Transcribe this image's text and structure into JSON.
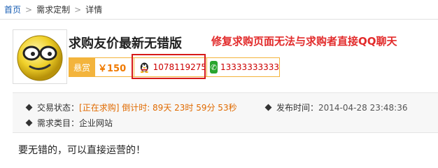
{
  "breadcrumb": {
    "home": "首页",
    "separator": ">",
    "items": [
      "需求定制",
      "详情"
    ]
  },
  "request": {
    "title": "求购友价最新无错版",
    "annotation": "修复求购页面无法与求购者直接QQ聊天",
    "reward": {
      "label": "悬赏",
      "value": "￥150"
    },
    "qq": "1078119275",
    "phone": "13333333333"
  },
  "info": {
    "status_label": "交易状态：",
    "status_value": "[正在求购] 倒计时: 89天 23时 59分 53秒",
    "category_label": "需求类目：",
    "category_value": "企业网站",
    "publish_label": "发布时间：",
    "publish_value": "2014-04-28 23:48:36"
  },
  "description": "要无错的，可以直接运营的！",
  "colors": {
    "accent": "#f3b43c",
    "price": "#f07a00",
    "annotation": "#e22b2b",
    "highlight": "#d61a1a",
    "link": "#1a5fb4"
  },
  "icons": {
    "avatar": "smiley-with-glasses",
    "qq": "qq-penguin-icon",
    "phone": "phone-icon"
  }
}
